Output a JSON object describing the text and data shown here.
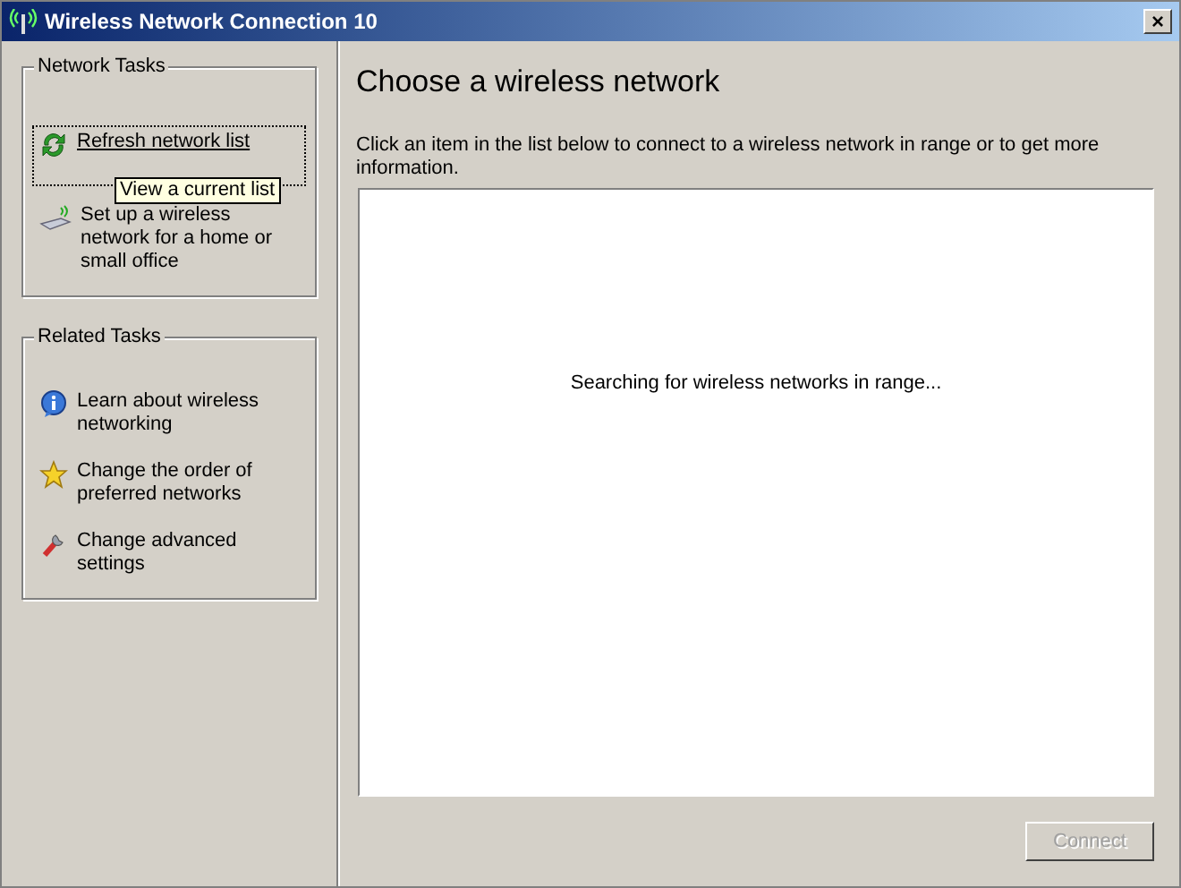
{
  "window": {
    "title": "Wireless Network Connection 10",
    "close_label": "×"
  },
  "task_groups": [
    {
      "title": "Network Tasks",
      "items": [
        {
          "label": "Refresh network list",
          "focused": true
        },
        {
          "label": "Set up a wireless network for a home or small office",
          "focused": false
        }
      ]
    },
    {
      "title": "Related Tasks",
      "items": [
        {
          "label": "Learn about wireless networking",
          "focused": false
        },
        {
          "label": "Change the order of preferred networks",
          "focused": false
        },
        {
          "label": "Change advanced settings",
          "focused": false
        }
      ]
    }
  ],
  "tooltip": "View a current list",
  "heading": "Choose a wireless network",
  "description": "Click an item in the list below to connect to a wireless network in range or to get more information.",
  "network_list": {
    "status": "Searching for wireless networks in range..."
  },
  "connect_button": {
    "label": "Connect",
    "disabled": true
  }
}
